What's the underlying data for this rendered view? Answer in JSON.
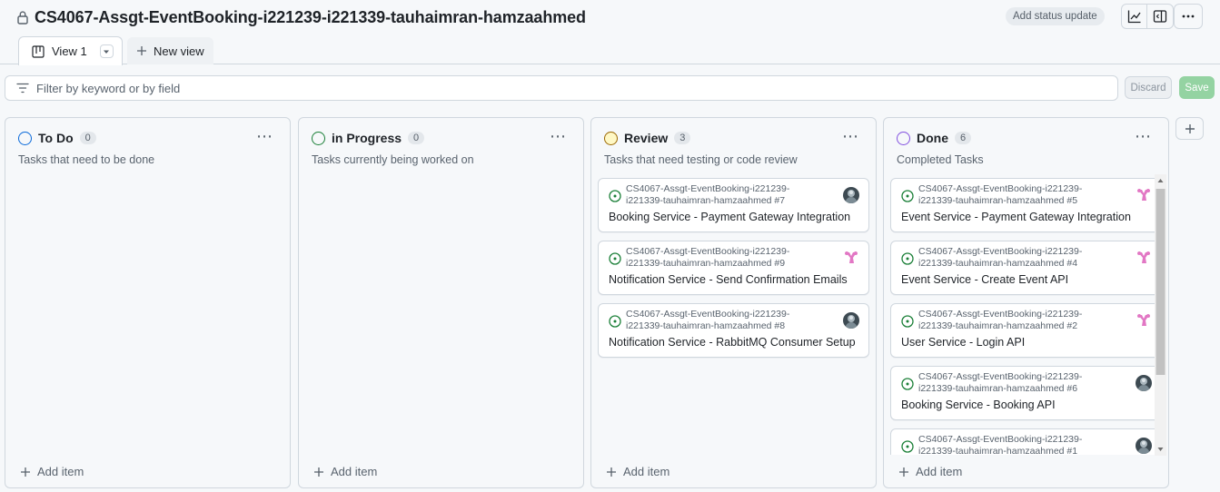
{
  "header": {
    "project_title": "CS4067-Assgt-EventBooking-i221239-i221339-tauhaimran-hamzaahmed",
    "status_update_label": "Add status update"
  },
  "tabs": {
    "view_label": "View 1",
    "new_view_label": "New view"
  },
  "filter": {
    "placeholder": "Filter by keyword or by field",
    "discard_label": "Discard",
    "save_label": "Save"
  },
  "colors": {
    "todo": "#0969da",
    "in_progress": "#1a7f37",
    "review": "#9a6700",
    "done": "#8250df",
    "issue_open": "#1a7f37"
  },
  "columns": [
    {
      "title": "To Do",
      "count": "0",
      "description": "Tasks that need to be done",
      "add_label": "Add item",
      "cards": []
    },
    {
      "title": "in Progress",
      "count": "0",
      "description": "Tasks currently being worked on",
      "add_label": "Add item",
      "cards": []
    },
    {
      "title": "Review",
      "count": "3",
      "description": "Tasks that need testing or code review",
      "add_label": "Add item",
      "cards": [
        {
          "repo_line1": "CS4067-Assgt-EventBooking-i221239-",
          "repo_line2": "i221339-tauhaimran-hamzaahmed #7",
          "title": "Booking Service - Payment Gateway Integration",
          "avatar": "photo"
        },
        {
          "repo_line1": "CS4067-Assgt-EventBooking-i221239-",
          "repo_line2": "i221339-tauhaimran-hamzaahmed #9",
          "title": "Notification Service - Send Confirmation Emails",
          "avatar": "pink"
        },
        {
          "repo_line1": "CS4067-Assgt-EventBooking-i221239-",
          "repo_line2": "i221339-tauhaimran-hamzaahmed #8",
          "title": "Notification Service - RabbitMQ Consumer Setup",
          "avatar": "photo"
        }
      ]
    },
    {
      "title": "Done",
      "count": "6",
      "description": "Completed Tasks",
      "add_label": "Add item",
      "cards": [
        {
          "repo_line1": "CS4067-Assgt-EventBooking-i221239-",
          "repo_line2": "i221339-tauhaimran-hamzaahmed #5",
          "title": "Event Service - Payment Gateway Integration",
          "avatar": "pink"
        },
        {
          "repo_line1": "CS4067-Assgt-EventBooking-i221239-",
          "repo_line2": "i221339-tauhaimran-hamzaahmed #4",
          "title": "Event Service - Create Event API",
          "avatar": "pink"
        },
        {
          "repo_line1": "CS4067-Assgt-EventBooking-i221239-",
          "repo_line2": "i221339-tauhaimran-hamzaahmed #2",
          "title": "User Service - Login API",
          "avatar": "pink"
        },
        {
          "repo_line1": "CS4067-Assgt-EventBooking-i221239-",
          "repo_line2": "i221339-tauhaimran-hamzaahmed #6",
          "title": "Booking Service - Booking API",
          "avatar": "photo"
        },
        {
          "repo_line1": "CS4067-Assgt-EventBooking-i221239-",
          "repo_line2": "i221339-tauhaimran-hamzaahmed #1",
          "title": "",
          "avatar": "photo"
        }
      ]
    }
  ]
}
